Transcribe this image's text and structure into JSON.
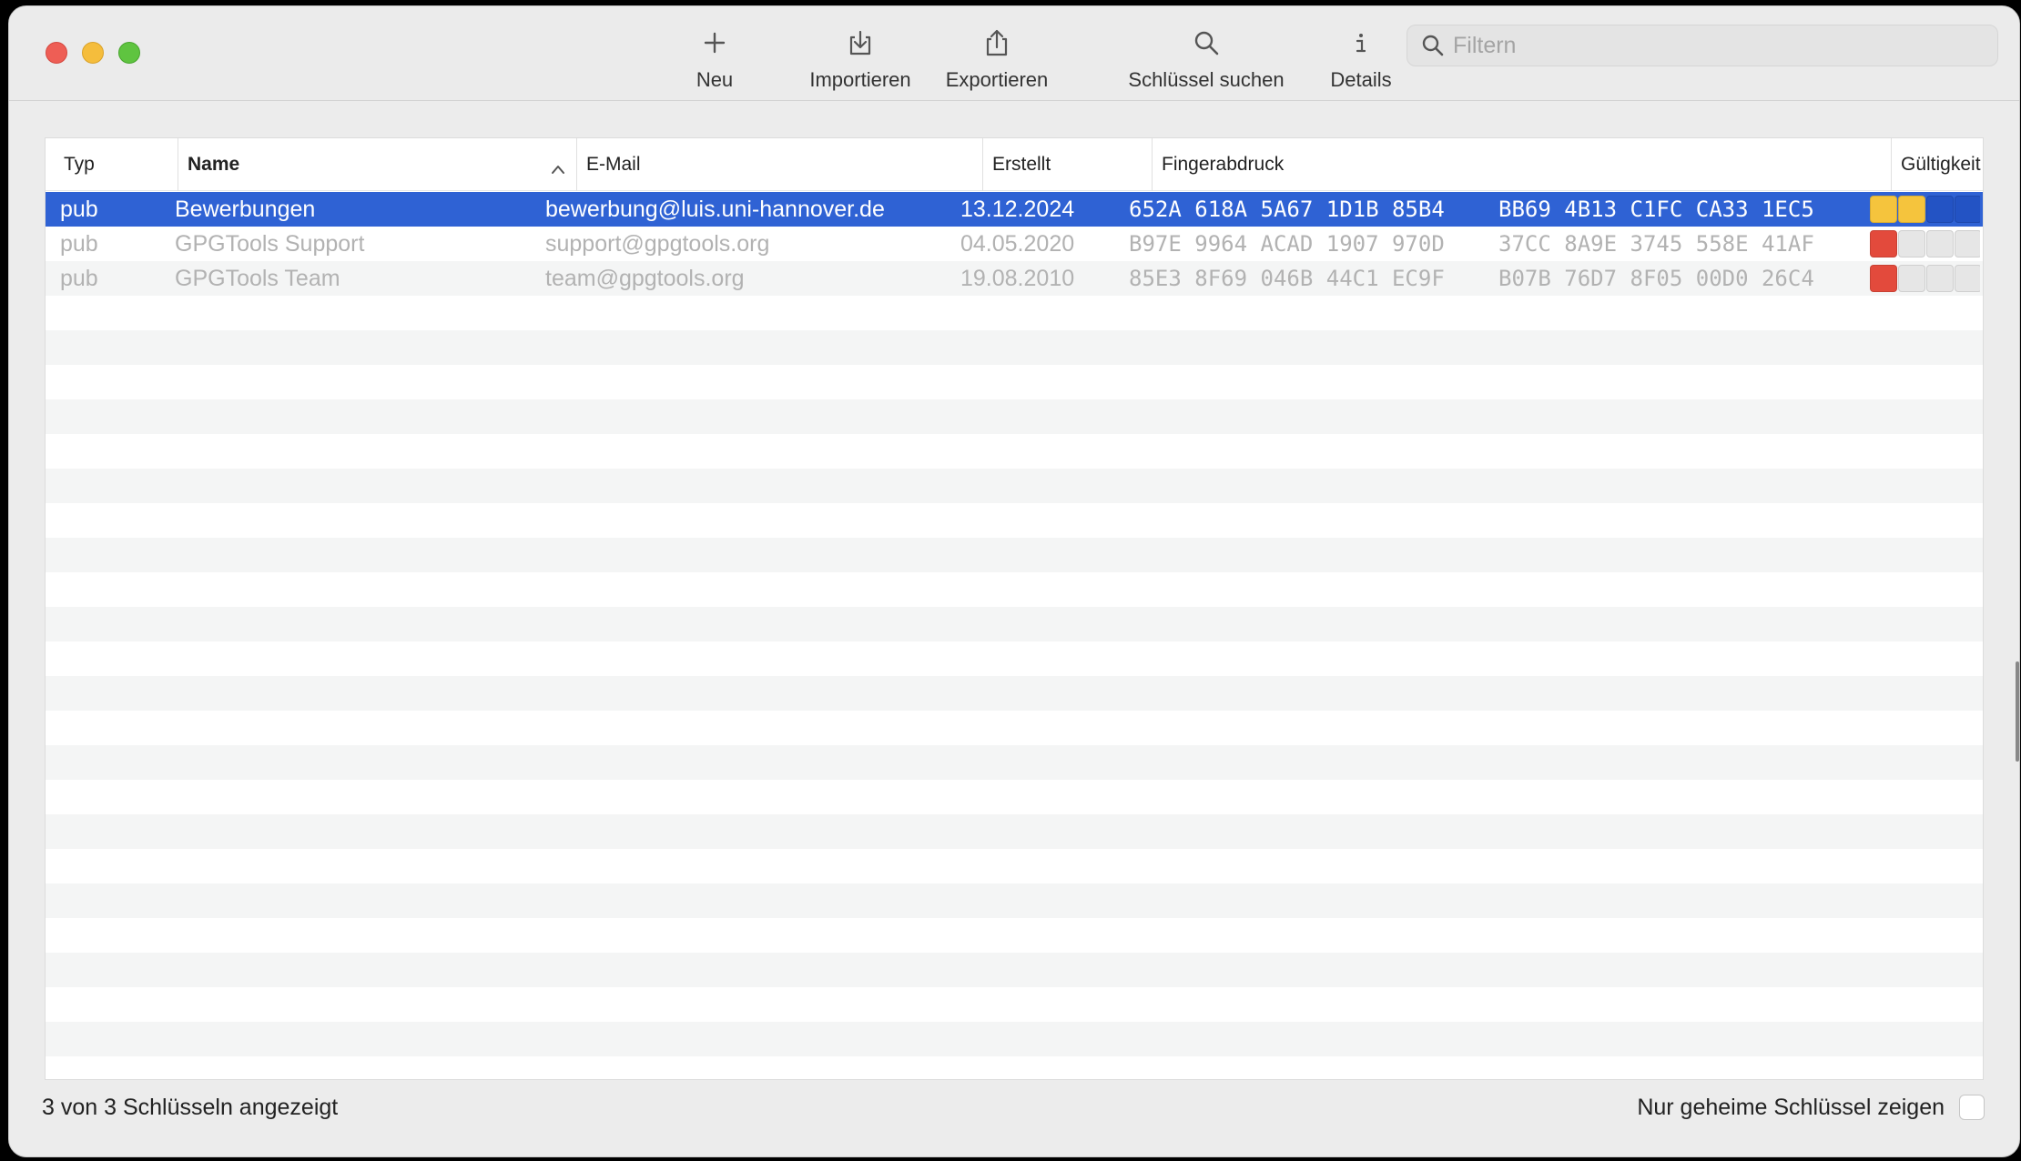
{
  "toolbar": {
    "new_label": "Neu",
    "import_label": "Importieren",
    "export_label": "Exportieren",
    "search_keys_label": "Schlüssel suchen",
    "details_label": "Details",
    "filter_placeholder": "Filtern"
  },
  "table": {
    "headers": {
      "type": "Typ",
      "name": "Name",
      "email": "E-Mail",
      "created": "Erstellt",
      "fingerprint": "Fingerabdruck",
      "validity": "Gültigkeit"
    },
    "sort": {
      "column": "Name",
      "direction": "ascending"
    },
    "rows": [
      {
        "type": "pub",
        "name": "Bewerbungen",
        "email": "bewerbung@luis.uni-hannover.de",
        "created": "13.12.2024",
        "fingerprint_a": "652A 618A 5A67 1D1B 85B4",
        "fingerprint_b": "BB69 4B13 C1FC CA33 1EC5",
        "validity_colors": [
          "#f5c43d",
          "#f5c43d",
          "#2353c4",
          "#2353c4"
        ],
        "selected": true
      },
      {
        "type": "pub",
        "name": "GPGTools Support",
        "email": "support@gpgtools.org",
        "created": "04.05.2020",
        "fingerprint_a": "B97E 9964 ACAD 1907 970D",
        "fingerprint_b": "37CC 8A9E 3745 558E 41AF",
        "validity_colors": [
          "#e34a3c",
          "#e6e6e6",
          "#e6e6e6",
          "#e6e6e6"
        ],
        "selected": false
      },
      {
        "type": "pub",
        "name": "GPGTools Team",
        "email": "team@gpgtools.org",
        "created": "19.08.2010",
        "fingerprint_a": "85E3 8F69 046B 44C1 EC9F",
        "fingerprint_b": "B07B 76D7 8F05 00D0 26C4",
        "validity_colors": [
          "#e34a3c",
          "#e6e6e6",
          "#e6e6e6",
          "#e6e6e6"
        ],
        "selected": false
      }
    ]
  },
  "footer": {
    "status": "3 von 3 Schlüsseln angezeigt",
    "secret_only_label": "Nur geheime Schlüssel zeigen",
    "secret_only_checked": false
  },
  "colors": {
    "selection": "#2f62d4",
    "stripe": "#f4f5f5"
  }
}
